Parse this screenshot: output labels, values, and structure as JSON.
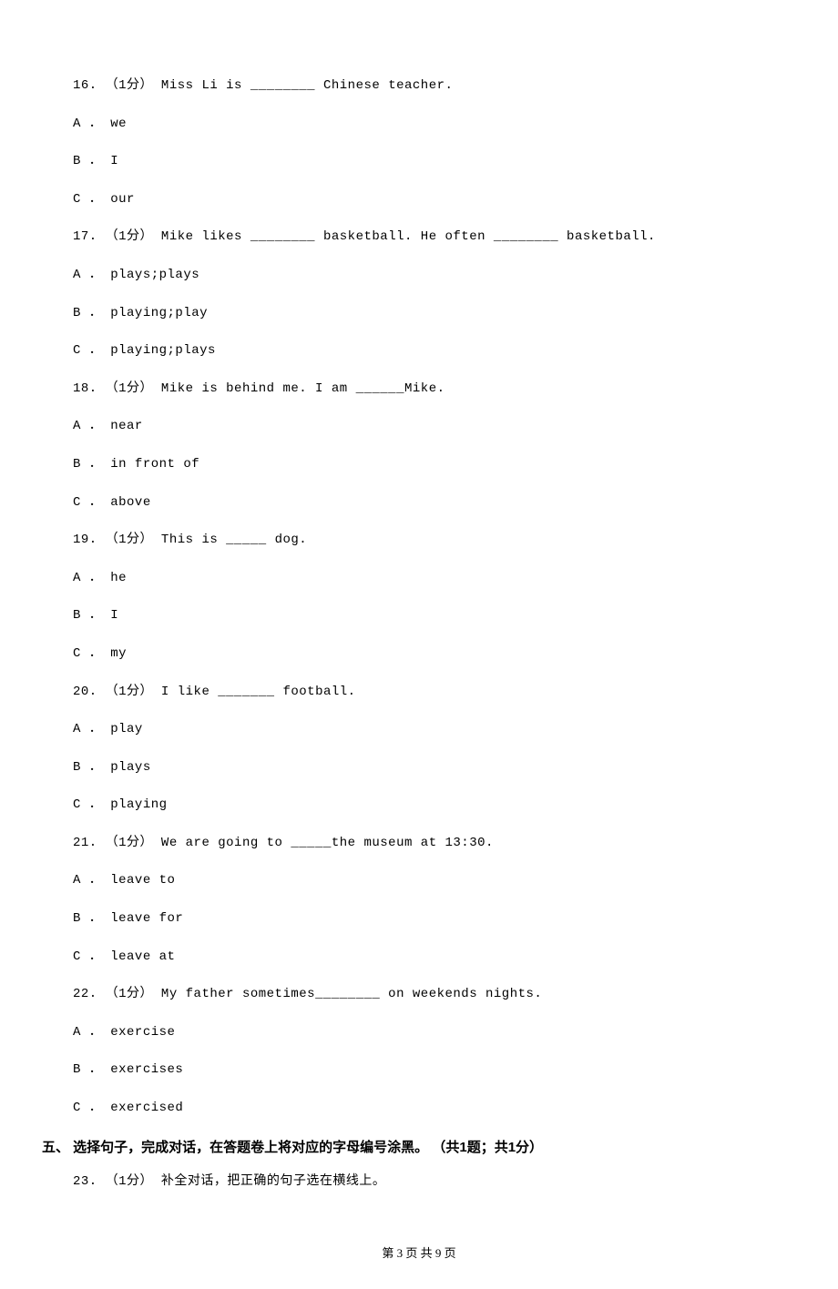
{
  "questions": [
    {
      "num": "16.",
      "points": "（1分）",
      "text_before": " Miss Li is ",
      "blank": "________",
      "text_after": " Chinese teacher.",
      "options": [
        {
          "label": "A ．",
          "text": "we"
        },
        {
          "label": "B ．",
          "text": "I"
        },
        {
          "label": "C ．",
          "text": "our"
        }
      ]
    },
    {
      "num": "17.",
      "points": "（1分）",
      "text_before": " Mike likes ",
      "blank": "________",
      "text_mid": " basketball. He often ",
      "blank2": "________",
      "text_after": " basketball.",
      "options": [
        {
          "label": "A ．",
          "text": "plays;plays"
        },
        {
          "label": "B ．",
          "text": "playing;play"
        },
        {
          "label": "C ．",
          "text": "playing;plays"
        }
      ]
    },
    {
      "num": "18.",
      "points": "（1分）",
      "text_before": " Mike is behind me. I am ",
      "blank": "______",
      "text_after": "Mike.",
      "options": [
        {
          "label": "A ．",
          "text": "near"
        },
        {
          "label": "B ．",
          "text": "in front of"
        },
        {
          "label": "C ．",
          "text": "above"
        }
      ]
    },
    {
      "num": "19.",
      "points": "（1分）",
      "text_before": " This is ",
      "blank": "_____",
      "text_after": " dog.",
      "options": [
        {
          "label": "A ．",
          "text": "he"
        },
        {
          "label": "B ．",
          "text": "I"
        },
        {
          "label": "C ．",
          "text": "my"
        }
      ]
    },
    {
      "num": "20.",
      "points": "（1分）",
      "text_before": " I like ",
      "blank": "_______",
      "text_after": " football.",
      "options": [
        {
          "label": "A ．",
          "text": "play"
        },
        {
          "label": "B ．",
          "text": "plays"
        },
        {
          "label": "C ．",
          "text": "playing"
        }
      ]
    },
    {
      "num": "21.",
      "points": "（1分）",
      "text_before": " We are going to ",
      "blank": "_____",
      "text_after": "the museum at 13:30.",
      "options": [
        {
          "label": "A ．",
          "text": "leave to"
        },
        {
          "label": "B ．",
          "text": "leave for"
        },
        {
          "label": "C ．",
          "text": "leave at"
        }
      ]
    },
    {
      "num": "22.",
      "points": "（1分）",
      "text_before": " My father sometimes",
      "blank": "________",
      "text_after": " on weekends nights.",
      "options": [
        {
          "label": "A ．",
          "text": "exercise"
        },
        {
          "label": "B ．",
          "text": "exercises"
        },
        {
          "label": "C ．",
          "text": "exercised"
        }
      ]
    }
  ],
  "section5": {
    "prefix": "五、",
    "title": " 选择句子，完成对话，在答题卷上将对应的字母编号涂黑。 （共1题；共1分）"
  },
  "q23": {
    "num": "23.",
    "points": "（1分）",
    "text": " 补全对话，把正确的句子选在横线上。"
  },
  "footer": "第 3 页 共 9 页"
}
